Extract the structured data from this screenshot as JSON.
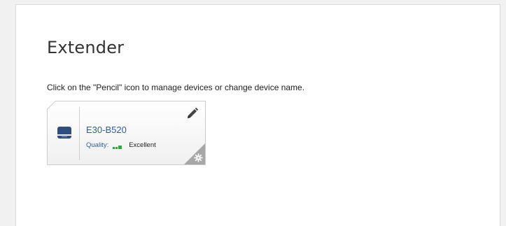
{
  "page": {
    "title": "Extender",
    "instructions": "Click on the \"Pencil\" icon to manage devices or change device name."
  },
  "device": {
    "name": "E30-B520",
    "quality_label": "Quality:",
    "quality_value": "Excellent",
    "signal_bars_active": 3,
    "signal_color": "#3da13d",
    "icons": {
      "device": "extender-device-icon",
      "edit": "pencil-icon",
      "settings": "gear-icon"
    }
  },
  "colors": {
    "link_blue": "#2f5d9e",
    "panel_bg": "#ffffff",
    "page_bg": "#f1f1f1"
  }
}
